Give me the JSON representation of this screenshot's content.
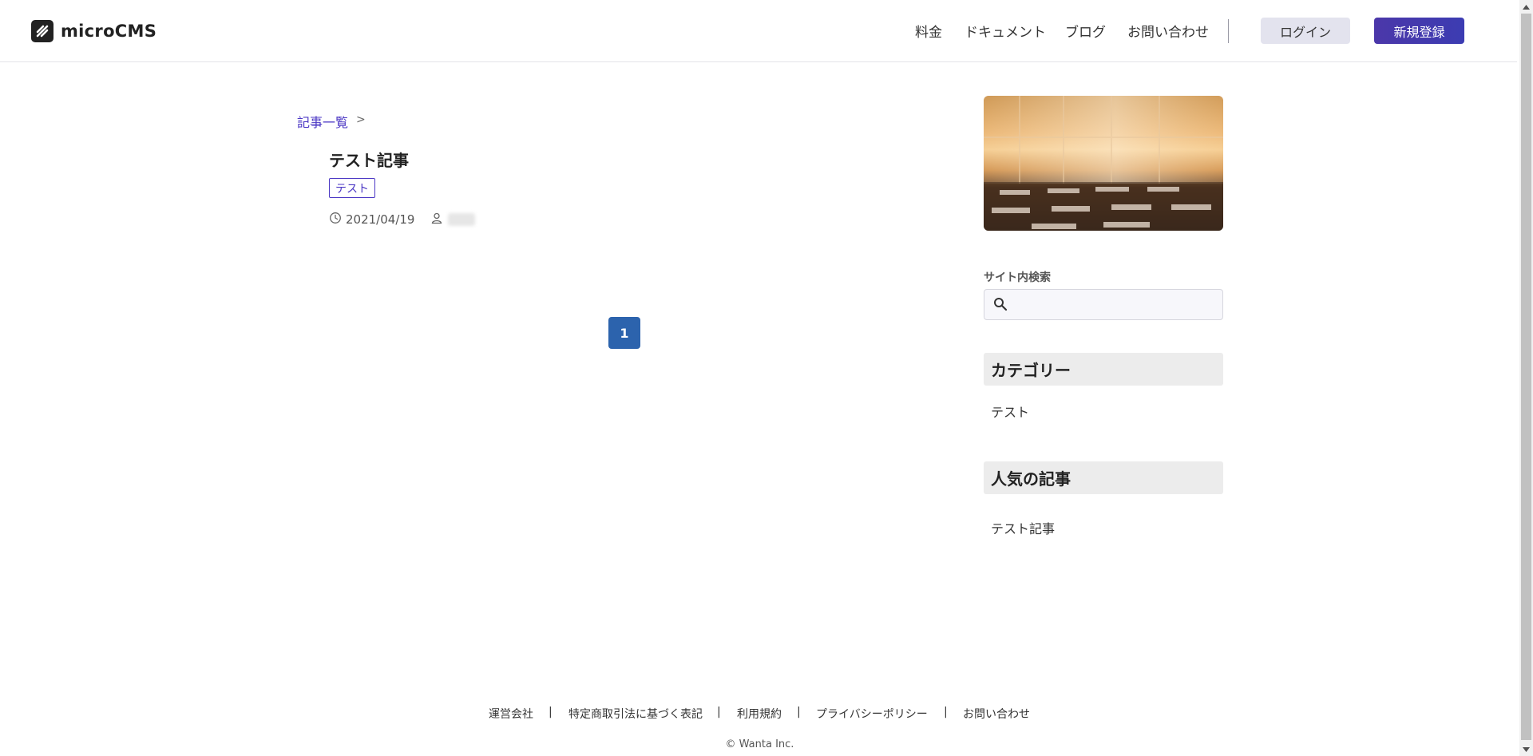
{
  "header": {
    "logo_text": "microCMS",
    "nav": [
      {
        "label": "料金"
      },
      {
        "label": "ドキュメント"
      },
      {
        "label": "ブログ"
      },
      {
        "label": "お問い合わせ"
      }
    ],
    "login_label": "ログイン",
    "signup_label": "新規登録",
    "colors": {
      "signup_bg": "#4b37a9",
      "login_bg": "#e3e3ee"
    }
  },
  "breadcrumb": {
    "home_label": "記事一覧",
    "separator": ">"
  },
  "article": {
    "title": "テスト記事",
    "tag": "テスト",
    "date": "2021/04/19"
  },
  "pagination": {
    "current": "1"
  },
  "sidebar": {
    "search_label": "サイト内検索",
    "search_value": "",
    "categories_heading": "カテゴリー",
    "categories": [
      "テスト"
    ],
    "popular_heading": "人気の記事",
    "popular": [
      "テスト記事"
    ]
  },
  "footer": {
    "links": [
      "運営会社",
      "特定商取引法に基づく表記",
      "利用規約",
      "プライバシーポリシー",
      "お問い合わせ"
    ],
    "separator": "|",
    "copyright": "© Wanta Inc."
  },
  "icons": {
    "logo": "microcms-logo-icon",
    "clock": "clock-icon",
    "user": "user-icon",
    "search": "search-icon"
  }
}
